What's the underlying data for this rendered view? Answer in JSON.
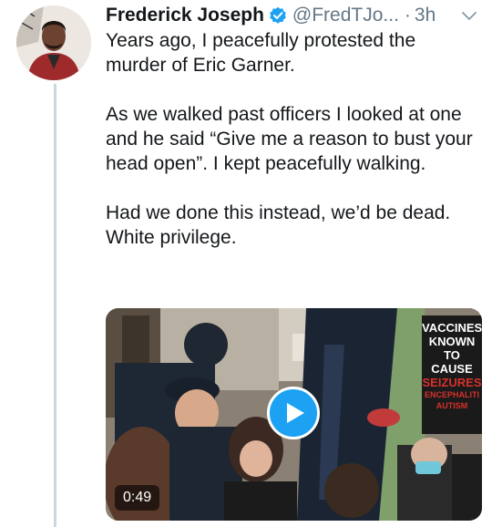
{
  "tweet": {
    "author_name": "Frederick Joseph",
    "handle": "@FredTJo...",
    "separator": "·",
    "time": "3h",
    "paragraphs": [
      "Years ago, I peacefully protested the murder of Eric Garner.",
      "As we walked past officers I looked at one and he said “Give me a reason to bust your head open”. I kept peacefully walking.",
      "Had we done this instead, we’d be dead. White privilege."
    ]
  },
  "video": {
    "duration": "0:49",
    "sign_lines": [
      "VACCINES",
      "KNOWN",
      "TO CAUSE",
      "SEIZURES",
      "ENCEPHALITI",
      "AUTISM"
    ]
  },
  "colors": {
    "accent": "#1da1f2",
    "text": "#14171a",
    "muted": "#657786",
    "thread_line": "#ccd6dd"
  },
  "icons": [
    "verified-badge-icon",
    "chevron-down-icon",
    "play-icon"
  ]
}
